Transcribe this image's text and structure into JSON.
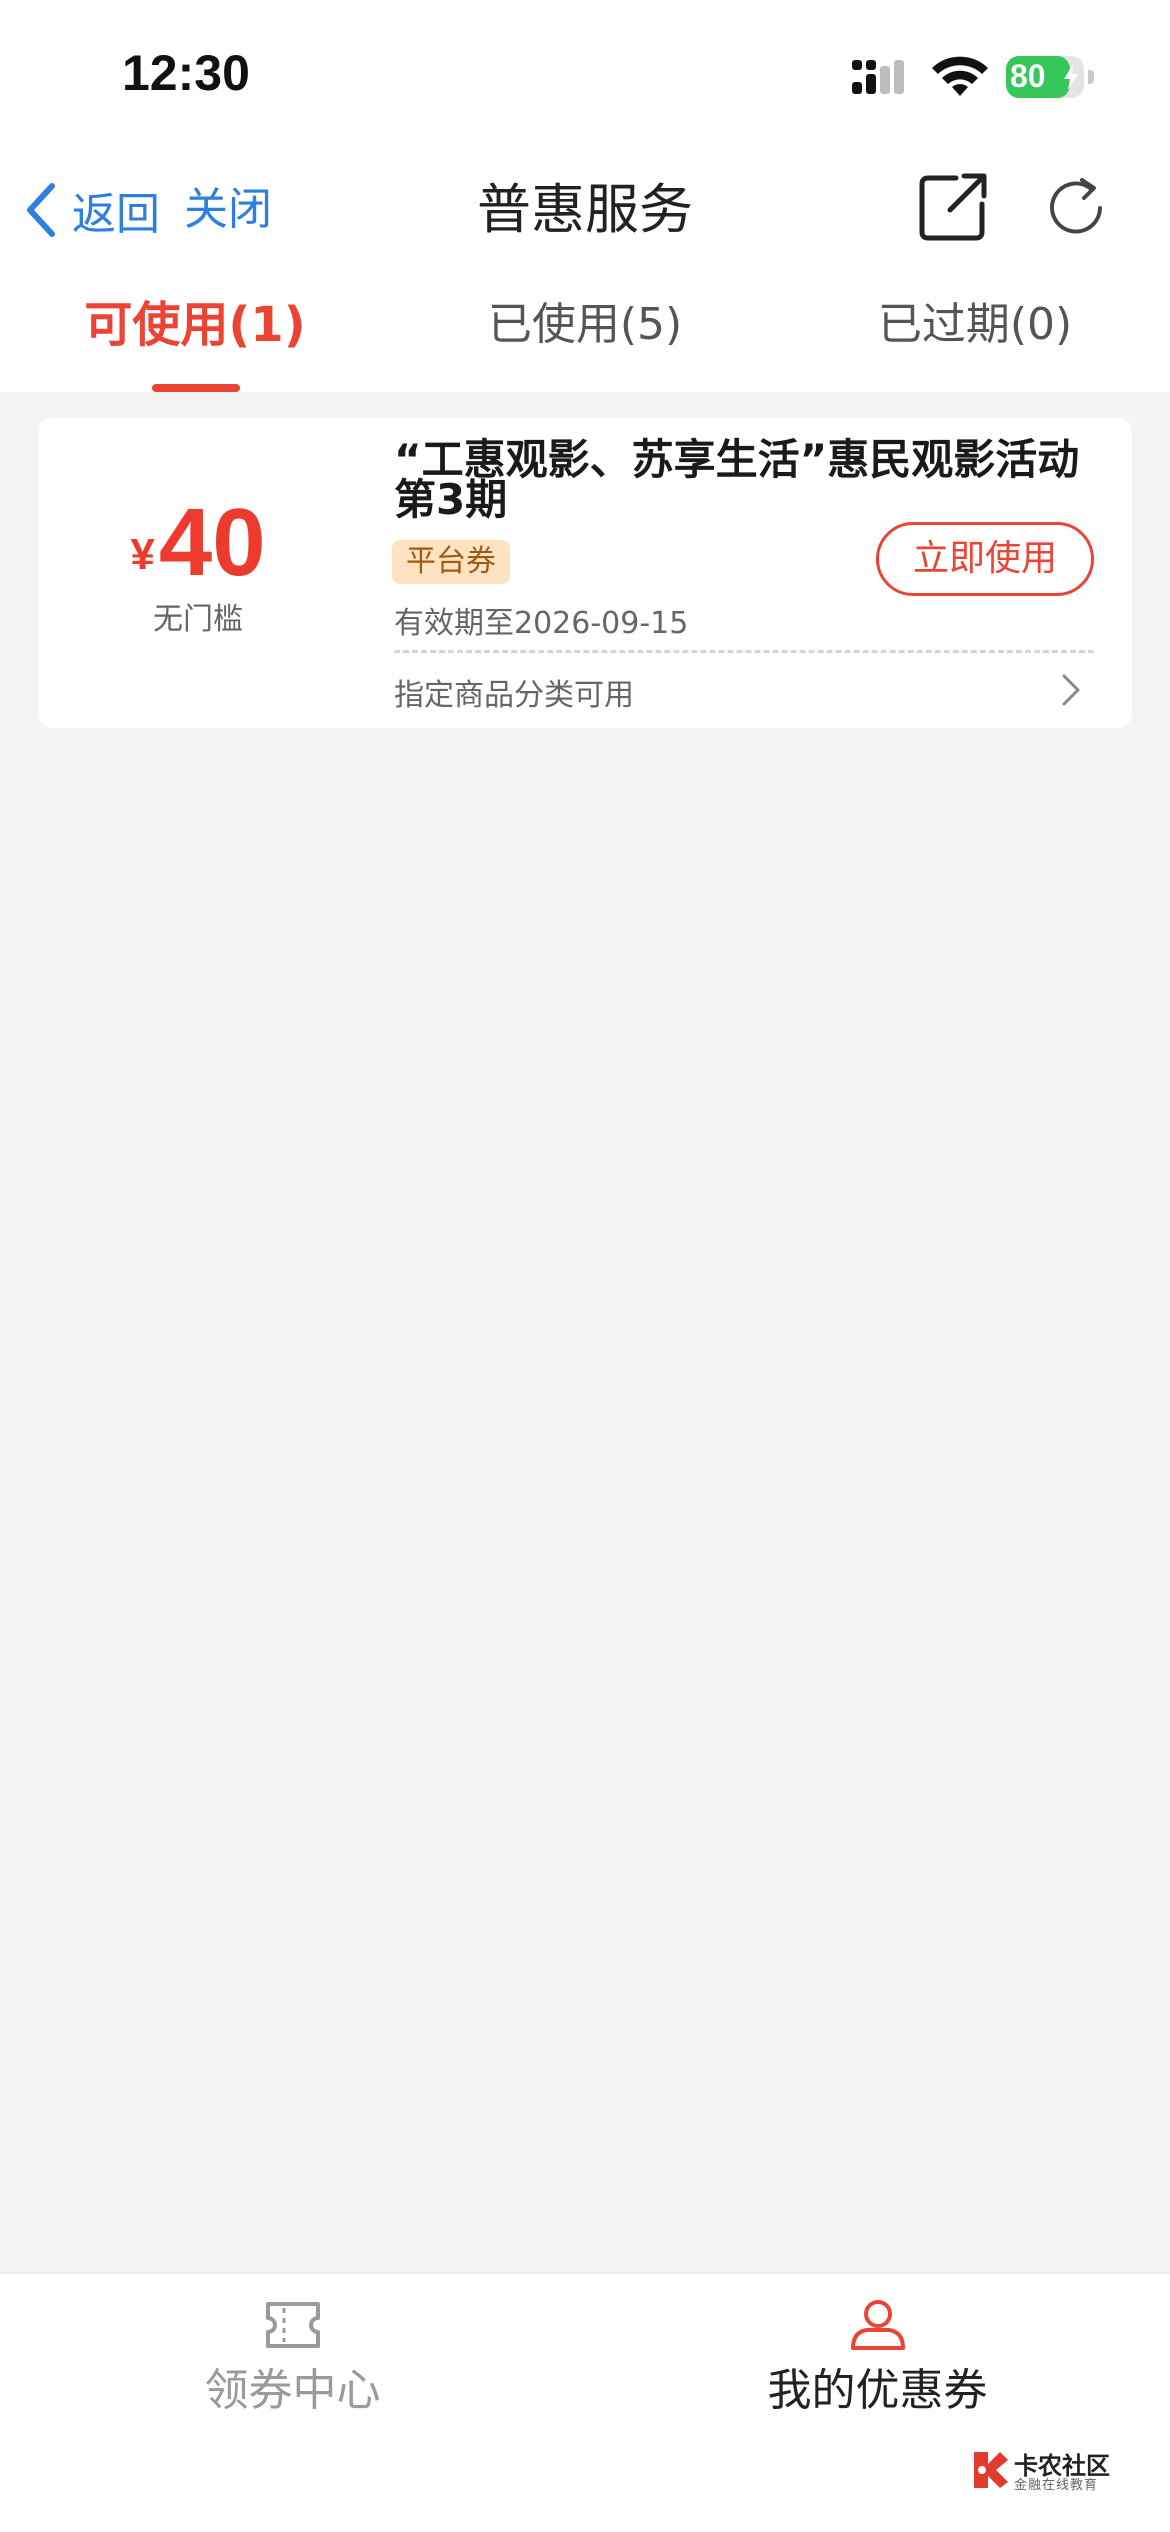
{
  "status_bar": {
    "time": "12:30",
    "battery_level": "80",
    "battery_color": "#35c759"
  },
  "nav": {
    "back_label": "返回",
    "close_label": "关闭",
    "title": "普惠服务",
    "icons": [
      "chevron-left-icon",
      "share-icon",
      "refresh-icon"
    ],
    "link_color": "#2d7fe0"
  },
  "tabs": [
    {
      "label": "可使用(1)",
      "active": true
    },
    {
      "label": "已使用(5)",
      "active": false
    },
    {
      "label": "已过期(0)",
      "active": false
    }
  ],
  "accent_color": "#ec4434",
  "coupon": {
    "currency": "¥",
    "amount": "40",
    "threshold": "无门槛",
    "title": "“工惠观影、苏享生活”惠民观影活动第3期",
    "tag": "平台券",
    "use_button": "立即使用",
    "validity": "有效期至2026-09-15",
    "scope": "指定商品分类可用"
  },
  "bottom_nav": [
    {
      "label": "领券中心",
      "icon": "ticket-icon",
      "active": false
    },
    {
      "label": "我的优惠券",
      "icon": "user-icon",
      "active": true
    }
  ],
  "watermark": {
    "title": "卡农社区",
    "subtitle": "金融在线教育"
  }
}
